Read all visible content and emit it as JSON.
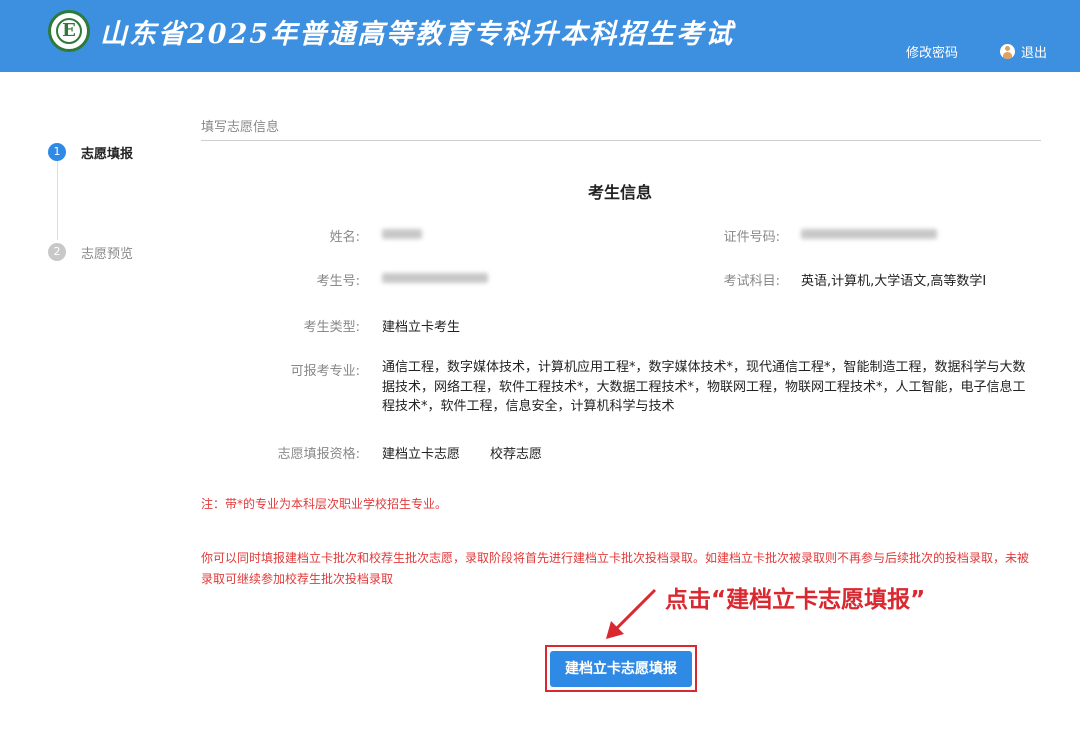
{
  "header": {
    "title": "山东省2025年普通高等教育专科升本科招生考试",
    "change_password": "修改密码",
    "logout": "退出",
    "logo_letter": "E",
    "bg_color": "#3d8fe0"
  },
  "steps": [
    {
      "num": "1",
      "label": "志愿填报",
      "state": "active"
    },
    {
      "num": "2",
      "label": "志愿预览",
      "state": "inactive"
    }
  ],
  "section": {
    "title": "填写志愿信息",
    "info_title": "考生信息"
  },
  "fields": {
    "name_label": "姓名:",
    "id_label": "证件号码:",
    "exam_no_label": "考生号:",
    "subjects_label": "考试科目:",
    "subjects_value": "英语,计算机,大学语文,高等数学Ⅰ",
    "type_label": "考生类型:",
    "type_value": "建档立卡考生",
    "majors_label": "可报考专业:",
    "majors_value": "通信工程，数字媒体技术，计算机应用工程*，数字媒体技术*，现代通信工程*，智能制造工程，数据科学与大数据技术，网络工程，软件工程技术*，大数据工程技术*，物联网工程，物联网工程技术*，人工智能，电子信息工程技术*，软件工程，信息安全，计算机科学与技术",
    "qualify_label": "志愿填报资格:",
    "qualify_values": [
      "建档立卡志愿",
      "校荐志愿"
    ]
  },
  "notes": {
    "note1": "注：带*的专业为本科层次职业学校招生专业。",
    "note2": "你可以同时填报建档立卡批次和校荐生批次志愿，录取阶段将首先进行建档立卡批次投档录取。如建档立卡批次被录取则不再参与后续批次的投档录取，未被录取可继续参加校荐生批次投档录取"
  },
  "callout": "点击“建档立卡志愿填报”",
  "button": {
    "label": "建档立卡志愿填报",
    "color": "#2f8ae5"
  },
  "accent_red": "#d9282f"
}
